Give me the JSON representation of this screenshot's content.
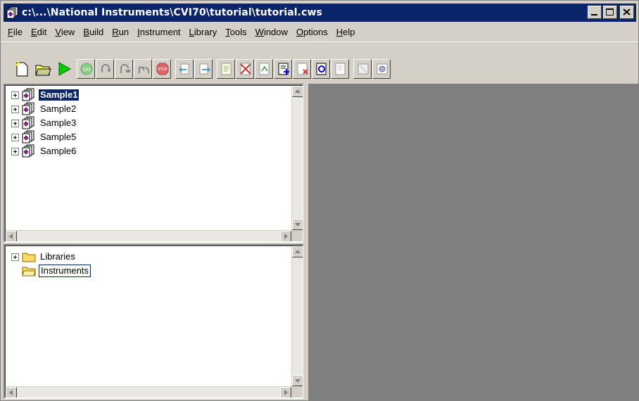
{
  "window": {
    "title": "c:\\...\\National Instruments\\CVI70\\tutorial\\tutorial.cws",
    "app_icon": "cvi-project-icon",
    "controls": [
      "minimize",
      "maximize",
      "close"
    ]
  },
  "menubar": {
    "items": [
      {
        "label": "File",
        "accel": "F",
        "rest": "ile"
      },
      {
        "label": "Edit",
        "accel": "E",
        "rest": "dit"
      },
      {
        "label": "View",
        "accel": "V",
        "rest": "iew"
      },
      {
        "label": "Build",
        "accel": "B",
        "rest": "uild"
      },
      {
        "label": "Run",
        "accel": "R",
        "rest": "un"
      },
      {
        "label": "Instrument",
        "accel": "I",
        "rest": "nstrument"
      },
      {
        "label": "Library",
        "accel": "L",
        "rest": "ibrary"
      },
      {
        "label": "Tools",
        "accel": "T",
        "rest": "ools"
      },
      {
        "label": "Window",
        "accel": "W",
        "rest": "indow"
      },
      {
        "label": "Options",
        "accel": "O",
        "rest": "ptions"
      },
      {
        "label": "Help",
        "accel": "H",
        "rest": "elp"
      }
    ]
  },
  "toolbar": {
    "buttons": [
      "new-file-icon",
      "open-folder-icon",
      "run-icon",
      "go-icon",
      "step-into-icon",
      "step-over-icon",
      "finish-function-icon",
      "terminate-icon",
      "breakpoint-prev-icon",
      "breakpoint-next-icon",
      "toggle-breakpoint-icon",
      "clear-breakpoints-icon",
      "breakpoints-list-icon",
      "add-file-icon",
      "remove-file-icon",
      "refresh-icon",
      "view-file-icon",
      "source-icon",
      "function-panel-icon"
    ]
  },
  "project_tree": {
    "items": [
      {
        "label": "Sample1",
        "selected": true
      },
      {
        "label": "Sample2",
        "selected": false
      },
      {
        "label": "Sample3",
        "selected": false
      },
      {
        "label": "Sample5",
        "selected": false
      },
      {
        "label": "Sample6",
        "selected": false
      }
    ]
  },
  "library_tree": {
    "items": [
      {
        "label": "Libraries",
        "expandable": true
      },
      {
        "label": "Instruments",
        "expandable": false,
        "focused": true
      }
    ]
  },
  "colors": {
    "titlebar": "#0a246a",
    "face": "#d4d0c8",
    "mdi_background": "#808080",
    "selection": "#0a246a"
  }
}
